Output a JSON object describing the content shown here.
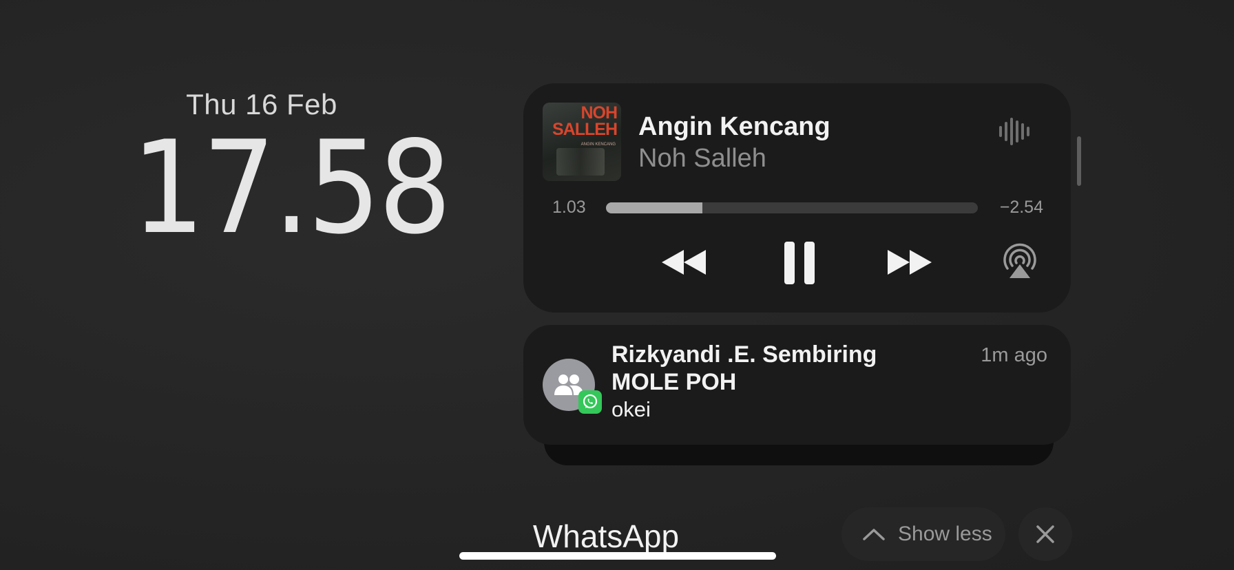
{
  "lockscreen": {
    "date": "Thu 16 Feb",
    "time": "17.58"
  },
  "now_playing": {
    "title": "Angin Kencang",
    "artist": "Noh Salleh",
    "album_art_text": "NOH\nSALLEH",
    "album_art_subtext": "ANGIN KENCANG",
    "elapsed": "1.03",
    "remaining": "−2.54",
    "progress_fraction": 0.26,
    "icons": {
      "audio": "waveform-icon",
      "rewind": "rewind-icon",
      "pause": "pause-icon",
      "forward": "fast-forward-icon",
      "airplay": "airplay-icon"
    }
  },
  "notification": {
    "sender": "Rizkyandi .E. Sembiring",
    "group": "MOLE POH",
    "message": "okei",
    "time_ago": "1m ago",
    "app_badge": "whatsapp-icon"
  },
  "footer": {
    "app_name": "WhatsApp",
    "show_less_label": "Show less"
  },
  "colors": {
    "background": "#242424",
    "card": "#1b1b1b",
    "whatsapp_green": "#34c759"
  }
}
